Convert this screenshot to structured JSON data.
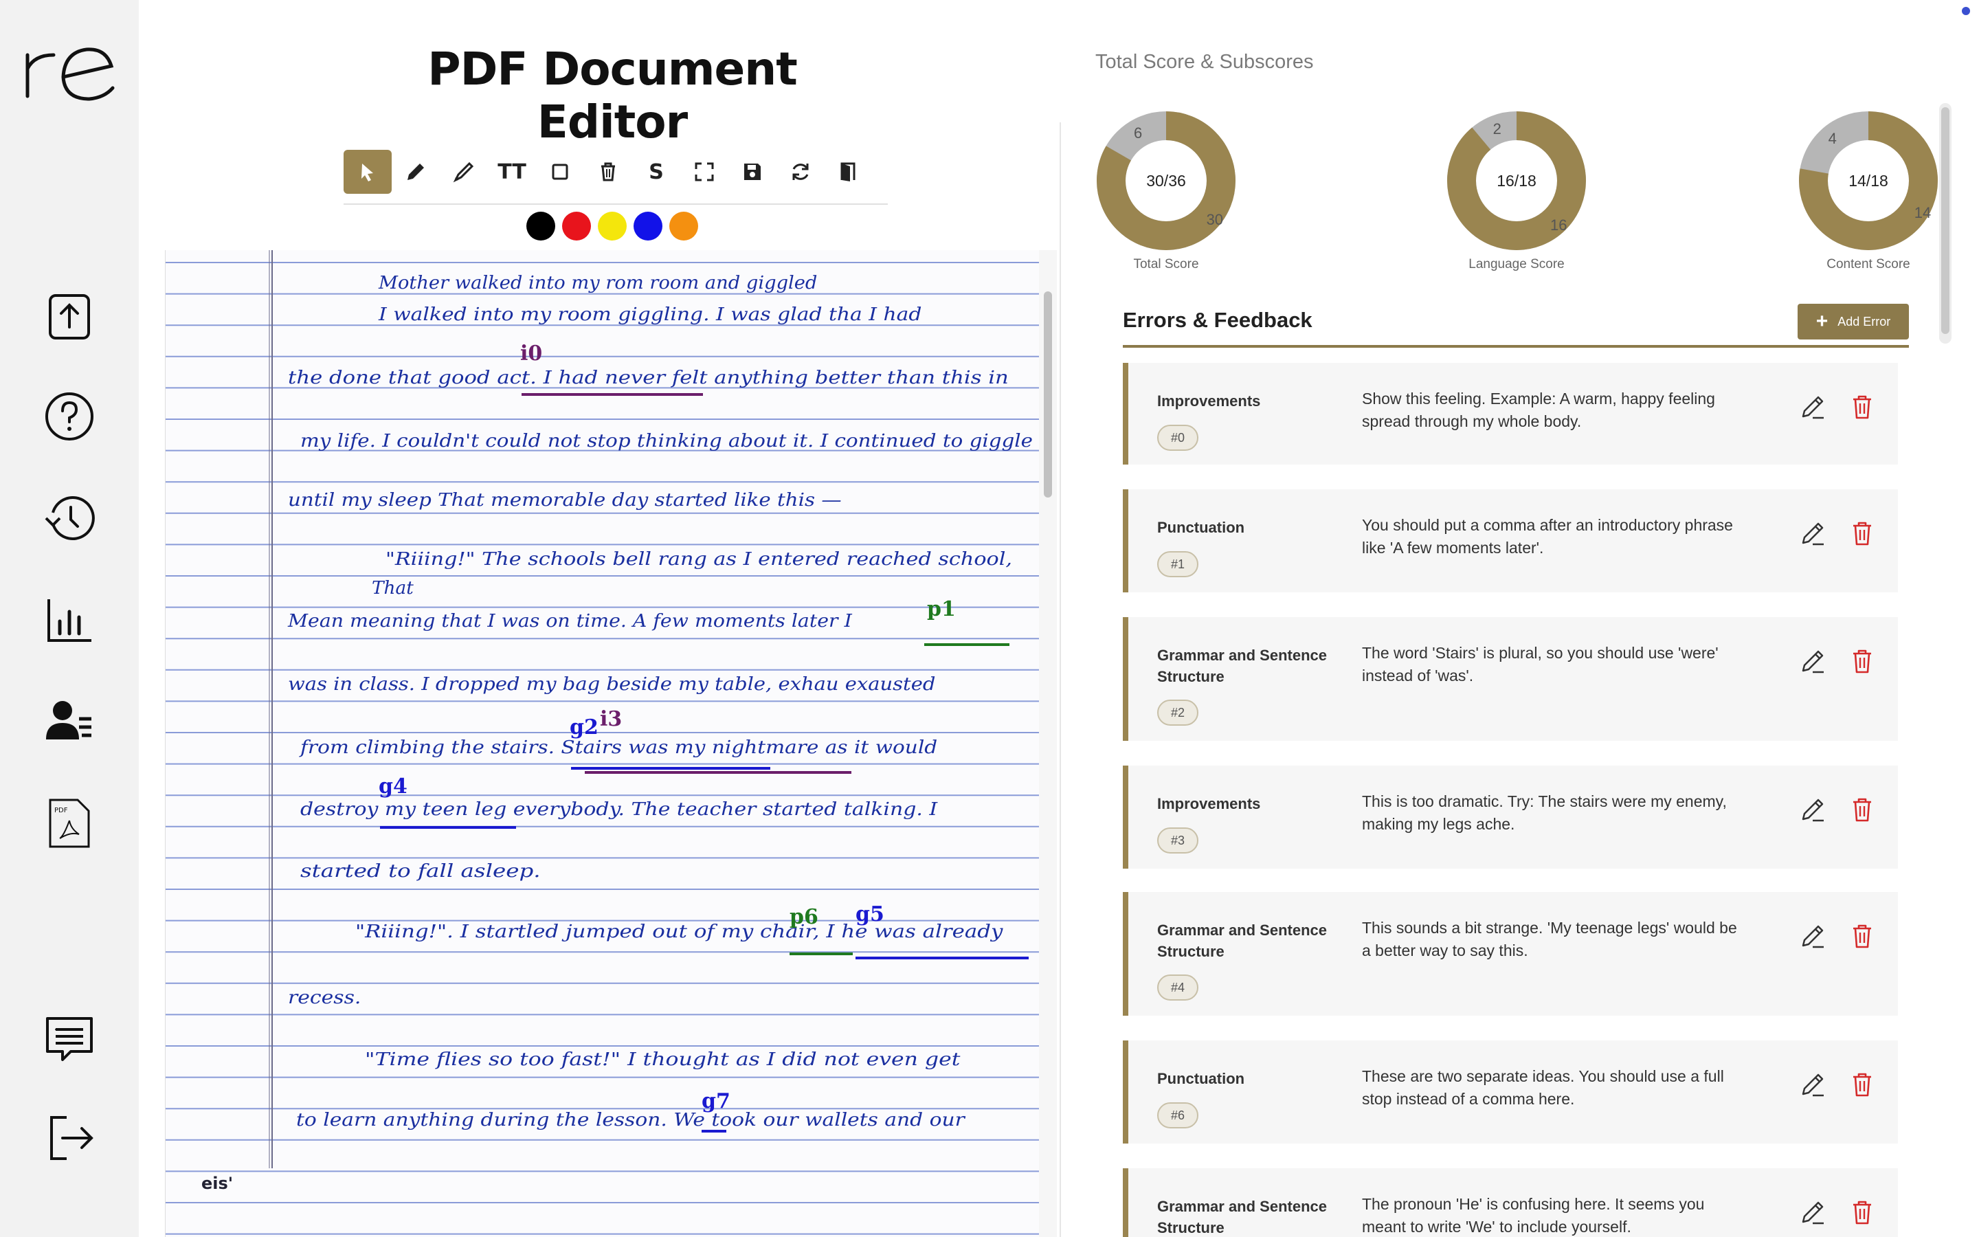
{
  "editor": {
    "title": "PDF Document Editor",
    "tools": [
      "select-tool",
      "pen-tool",
      "highlighter-tool",
      "text-size-tool",
      "rectangle-tool",
      "delete-tool",
      "strike-tool",
      "fullscreen-tool",
      "save-tool",
      "refresh-tool",
      "exit-tool"
    ],
    "strike_label": "S",
    "text_tool_label": "TT",
    "colors": [
      "#000000",
      "#e8141c",
      "#f4e60c",
      "#1212e8",
      "#f49010"
    ],
    "document": {
      "brand": "eis'",
      "markers": [
        {
          "label": "i0",
          "color": "#6b1e6b"
        },
        {
          "label": "p1",
          "color": "#1f7a1f"
        },
        {
          "label": "g2",
          "color": "#1a1ad0"
        },
        {
          "label": "i3",
          "color": "#6b1e6b"
        },
        {
          "label": "g4",
          "color": "#1a1ad0"
        },
        {
          "label": "g5",
          "color": "#1a1ad0"
        },
        {
          "label": "p6",
          "color": "#1f7a1f"
        },
        {
          "label": "g7",
          "color": "#1a1ad0"
        }
      ],
      "lines": [
        "Mother walked into my rom room and giggled",
        "I walked into my room giggling. I was glad tha I had",
        "the done that good act. I had never felt anything better than this in",
        "my life. I couldn't could not stop thinking about it. I continued to giggle",
        "until my sleep That memorable day started like this —",
        "\"Riiing!\" The schools bell rang as I entered reached school,",
        "That",
        "Mean meaning that I was on time. A few moments later I",
        "was in class. I dropped my bag beside my table, exhau exausted",
        "from climbing the stairs. Stairs was my nightmare as it would",
        "destroy my teen leg everybody. The teacher started talking. I",
        "started to fall asleep.",
        "\"Riiing!\". I startled jumped out of my chair, I he was already",
        "recess.",
        "\"Time flies so too fast!\" I thought as I did not even get",
        "to learn anything during the lesson. We took our wallets and our"
      ]
    }
  },
  "scores": {
    "heading": "Total Score & Subscores",
    "items": [
      {
        "label": "Total Score",
        "score": 30,
        "max": 36,
        "display": "30/36",
        "remaining": "6",
        "earned": "30"
      },
      {
        "label": "Language Score",
        "score": 16,
        "max": 18,
        "display": "16/18",
        "remaining": "2",
        "earned": "16"
      },
      {
        "label": "Content Score",
        "score": 14,
        "max": 18,
        "display": "14/18",
        "remaining": "4",
        "earned": "14"
      }
    ],
    "accent": "#9a8550",
    "rest_color": "#b6b6b6"
  },
  "feedback": {
    "title": "Errors & Feedback",
    "add_label": "Add Error",
    "cards": [
      {
        "category": "Improvements",
        "badge": "#0",
        "text": "Show this feeling. Example: A warm, happy feeling spread through my whole body."
      },
      {
        "category": "Punctuation",
        "badge": "#1",
        "text": "You should put a comma after an introductory phrase like 'A few moments later'."
      },
      {
        "category": "Grammar and Sentence Structure",
        "badge": "#2",
        "text": "The word 'Stairs' is plural, so you should use 'were' instead of 'was'."
      },
      {
        "category": "Improvements",
        "badge": "#3",
        "text": "This is too dramatic. Try: The stairs were my enemy, making my legs ache."
      },
      {
        "category": "Grammar and Sentence Structure",
        "badge": "#4",
        "text": "This sounds a bit strange. 'My teenage legs' would be a better way to say this."
      },
      {
        "category": "Punctuation",
        "badge": "#6",
        "text": "These are two separate ideas. You should use a full stop instead of a comma here."
      },
      {
        "category": "Grammar and Sentence Structure",
        "badge": "",
        "text": "The pronoun 'He' is confusing here. It seems you meant to write 'We' to include yourself."
      }
    ]
  },
  "sidebar": {
    "logo_text": "re",
    "items": [
      "upload-icon",
      "help-icon",
      "history-icon",
      "analytics-icon",
      "users-icon",
      "pdf-icon",
      "feedback-icon",
      "logout-icon"
    ]
  }
}
